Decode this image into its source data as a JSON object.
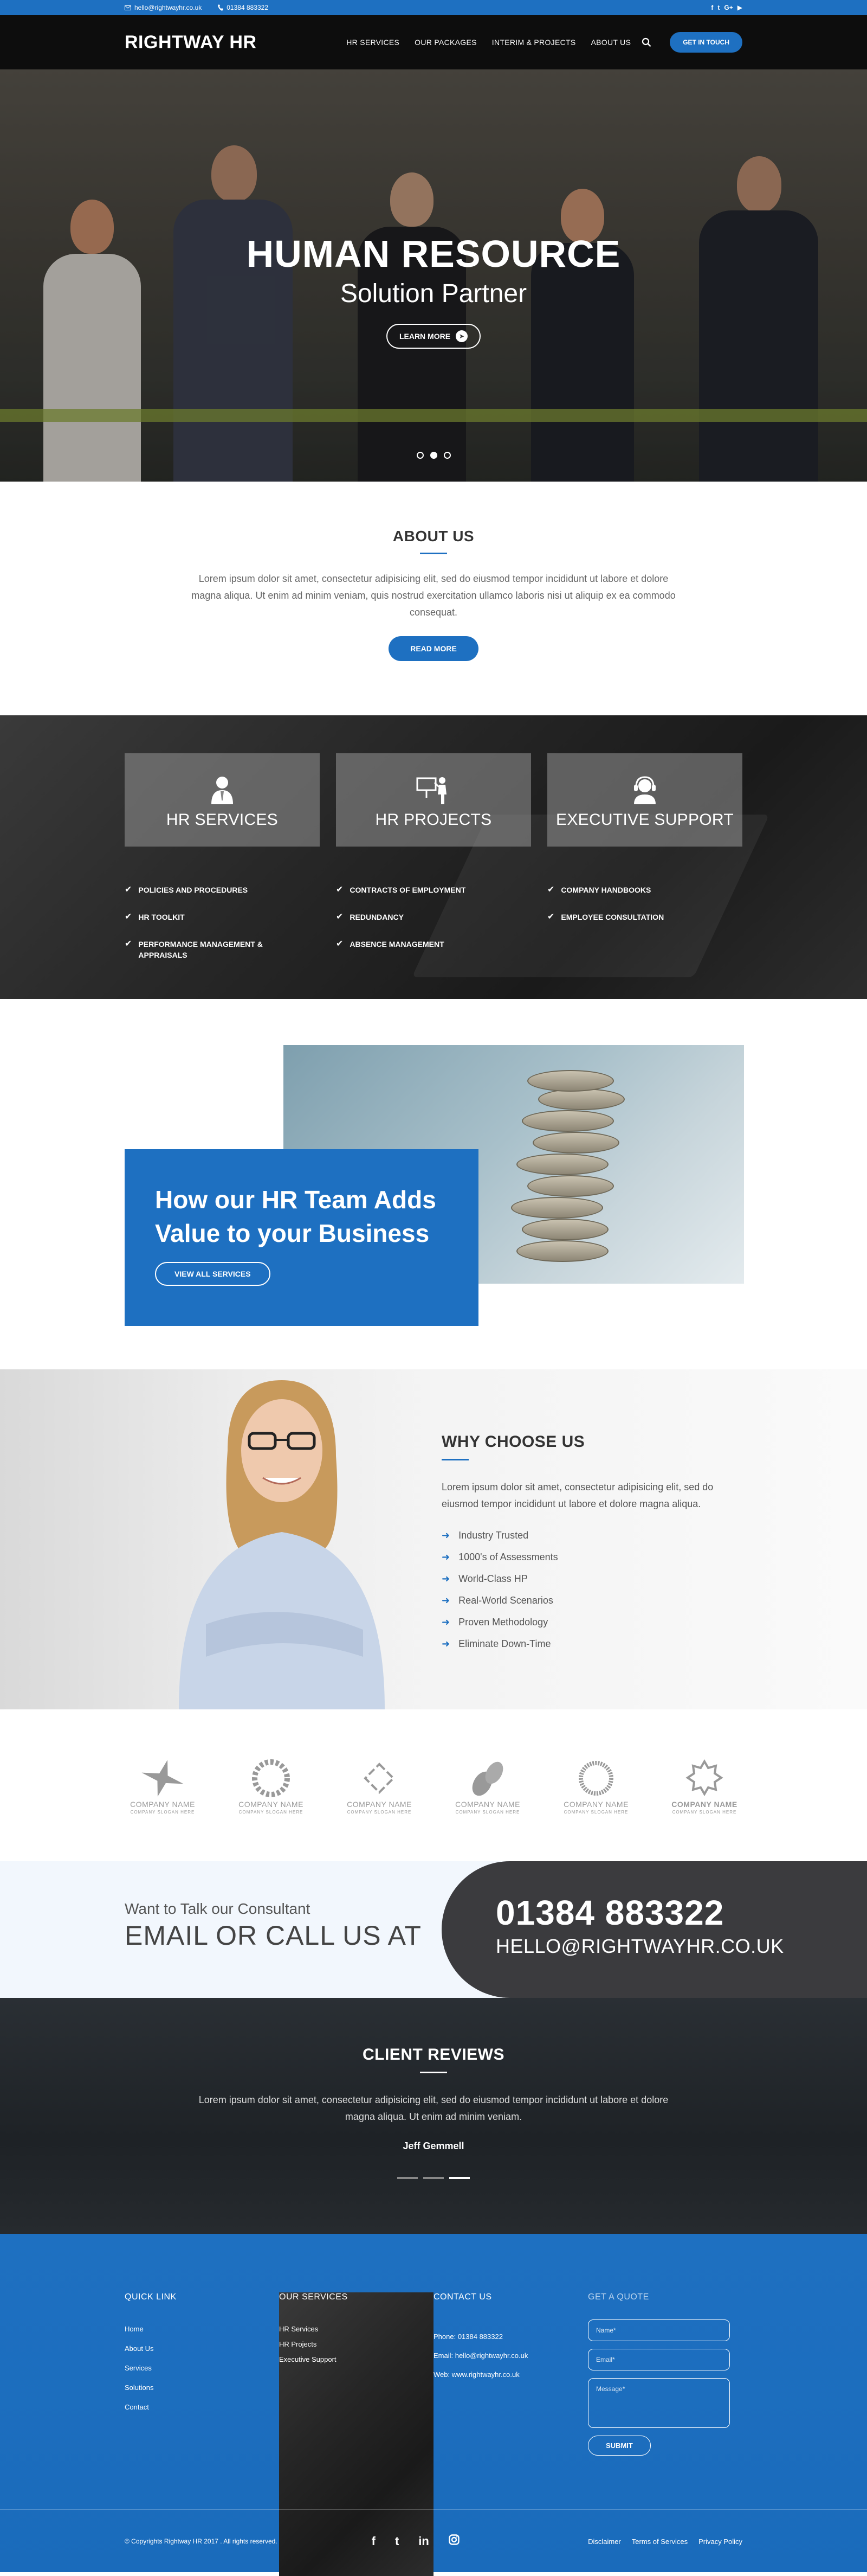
{
  "topbar": {
    "email": "hello@rightwayhr.co.uk",
    "phone": "01384 883322",
    "socials": [
      "f",
      "t",
      "G+",
      "▶"
    ]
  },
  "nav": {
    "logo": "RIGHTWAY HR",
    "items": [
      "HR SERVICES",
      "OUR PACKAGES",
      "INTERIM & PROJECTS",
      "ABOUT US"
    ],
    "cta": "GET IN TOUCH"
  },
  "hero": {
    "title": "HUMAN RESOURCE",
    "subtitle": "Solution Partner",
    "button": "LEARN MORE",
    "slides": 3,
    "active_slide": 2
  },
  "about": {
    "title": "ABOUT US",
    "text": "Lorem ipsum dolor sit amet, consectetur adipisicing elit, sed do eiusmod tempor incididunt ut labore et dolore magna aliqua. Ut enim ad minim veniam, quis nostrud exercitation ullamco laboris nisi ut aliquip ex ea commodo consequat.",
    "button": "READ MORE"
  },
  "services": {
    "cards": [
      {
        "name": "HR SERVICES",
        "icon": "person-icon"
      },
      {
        "name": "HR PROJECTS",
        "icon": "presentation-icon"
      },
      {
        "name": "EXECUTIVE SUPPORT",
        "icon": "headset-icon"
      }
    ],
    "lists": [
      [
        "POLICIES AND PROCEDURES",
        "HR TOOLKIT",
        "PERFORMANCE MANAGEMENT & APPRAISALS"
      ],
      [
        "CONTRACTS OF EMPLOYMENT",
        "REDUNDANCY",
        "ABSENCE MANAGEMENT"
      ],
      [
        "COMPANY HANDBOOKS",
        "EMPLOYEE CONSULTATION"
      ]
    ]
  },
  "value": {
    "title": "How our HR Team Adds Value to your Business",
    "button": "VIEW ALL SERVICES"
  },
  "why": {
    "title": "WHY CHOOSE US",
    "text": "Lorem ipsum dolor sit amet, consectetur adipisicing elit, sed do eiusmod tempor incididunt ut labore et dolore magna aliqua.",
    "items": [
      "Industry Trusted",
      "1000's of Assessments",
      "World-Class HP",
      "Real-World Scenarios",
      "Proven Methodology",
      "Eliminate Down-Time"
    ]
  },
  "clients": {
    "logos": [
      {
        "name": "COMPANY NAME",
        "tagline": "COMPANY SLOGAN HERE"
      },
      {
        "name": "COMPANY NAME",
        "tagline": "COMPANY SLOGAN HERE"
      },
      {
        "name": "COMPANY NAME",
        "tagline": "COMPANY SLOGAN HERE"
      },
      {
        "name": "COMPANY NAME",
        "tagline": "COMPANY SLOGAN HERE"
      },
      {
        "name": "COMPANY NAME",
        "tagline": "COMPANY SLOGAN HERE"
      },
      {
        "name": "COMPANY NAME",
        "tagline": "COMPANY SLOGAN HERE"
      }
    ]
  },
  "contact": {
    "small": "Want to Talk our Consultant",
    "big": "EMAIL OR CALL US AT",
    "phone": "01384 883322",
    "email": "HELLO@RIGHTWAYHR.CO.UK"
  },
  "reviews": {
    "title": "CLIENT REVIEWS",
    "text": "Lorem ipsum dolor sit amet, consectetur adipisicing elit, sed do eiusmod tempor incididunt ut labore et dolore magna aliqua. Ut enim ad minim veniam.",
    "author": "Jeff Gemmell",
    "slides": 3,
    "active_slide": 3
  },
  "footer": {
    "quick_link": {
      "title": "QUICK LINK",
      "items": [
        "Home",
        "About Us",
        "Services",
        "Solutions",
        "Contact"
      ]
    },
    "our_services": {
      "title": "OUR SERVICES",
      "items": [
        "HR Services",
        "HR Projects",
        "Executive Support"
      ]
    },
    "contact_us": {
      "title": "CONTACT US",
      "items": [
        "Phone: 01384 883322",
        "Email: hello@rightwayhr.co.uk",
        "Web: www.rightwayhr.co.uk"
      ]
    },
    "quote": {
      "title": "GET A QUOTE",
      "name_placeholder": "Name*",
      "email_placeholder": "Email*",
      "message_placeholder": "Message*",
      "submit": "SUBMIT"
    },
    "copyright": "© Copyrights Rightway HR 2017 . All rights reserved.",
    "socials": [
      "f",
      "t",
      "in",
      "ig"
    ],
    "links": [
      "Disclaimer",
      "Terms of Services",
      "Privacy Policy"
    ]
  },
  "colors": {
    "accent": "#1e70c1",
    "dark": "#0d0d0d",
    "band": "#3b3b3e"
  }
}
